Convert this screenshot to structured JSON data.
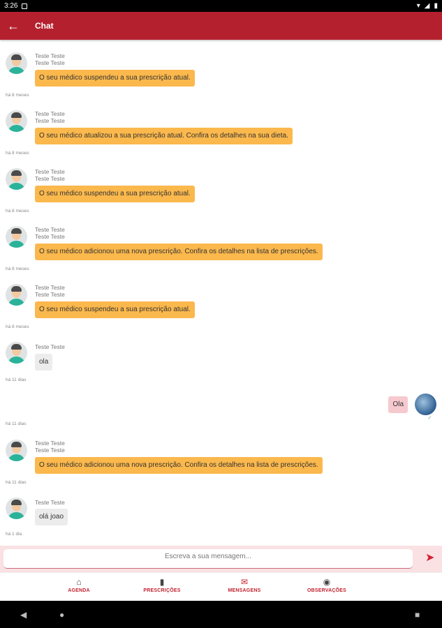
{
  "status_bar": {
    "time": "3:26"
  },
  "app_bar": {
    "title": "Chat",
    "back_icon": "arrow-left-icon"
  },
  "messages": [
    {
      "kind": "system",
      "sender_line1": "Teste Teste",
      "sender_line2": "Teste Teste",
      "text": "O seu médico suspendeu a sua prescrição atual.",
      "time": "há 8 meses"
    },
    {
      "kind": "system",
      "sender_line1": "Teste Teste",
      "sender_line2": "Teste Teste",
      "text": "O seu médico atualizou a sua prescrição atual. Confira os detalhes na sua dieta.",
      "time": "há 8 meses"
    },
    {
      "kind": "system",
      "sender_line1": "Teste Teste",
      "sender_line2": "Teste Teste",
      "text": "O seu médico suspendeu a sua prescrição atual.",
      "time": "há 8 meses"
    },
    {
      "kind": "system",
      "sender_line1": "Teste Teste",
      "sender_line2": "Teste Teste",
      "text": "O seu médico adicionou uma nova prescrição. Confira os detalhes na lista de prescrições.",
      "time": "há 8 meses"
    },
    {
      "kind": "system",
      "sender_line1": "Teste Teste",
      "sender_line2": "Teste Teste",
      "text": "O seu médico suspendeu a sua prescrição atual.",
      "time": "há 8 meses"
    },
    {
      "kind": "user",
      "sender_line1": "Teste Teste",
      "text": "ola",
      "time": "há 11 dias"
    },
    {
      "kind": "me",
      "text": "Ola",
      "time": "há 11 dias"
    },
    {
      "kind": "system",
      "sender_line1": "Teste Teste",
      "sender_line2": "Teste Teste",
      "text": "O seu médico adicionou uma nova prescrição. Confira os detalhes na lista de prescrições.",
      "time": "há 11 dias"
    },
    {
      "kind": "user",
      "sender_line1": "Teste Teste",
      "text": "olá joao",
      "time": "há 1 dia"
    }
  ],
  "composer": {
    "placeholder": "Escreva a sua mensagem...",
    "send_icon": "send-icon"
  },
  "bottom_nav": [
    {
      "label": "AGENDA",
      "icon": "home-icon"
    },
    {
      "label": "PRESCRIÇÕES",
      "icon": "clipboard-icon"
    },
    {
      "label": "MENSAGENS",
      "icon": "mail-icon",
      "active": true
    },
    {
      "label": "OBSERVAÇÕES",
      "icon": "eye-icon"
    }
  ],
  "colors": {
    "primary": "#b5202e",
    "system_bubble": "#fbb84c",
    "my_bubble": "#f6c9cf",
    "user_bubble": "#ececec"
  }
}
